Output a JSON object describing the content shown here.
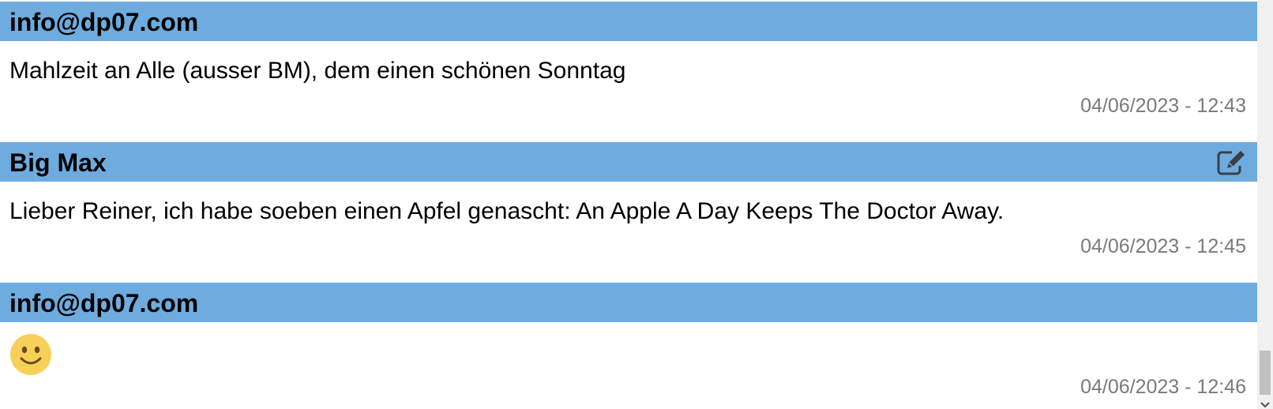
{
  "posts": [
    {
      "author": "info@dp07.com",
      "message": "Mahlzeit an Alle (ausser BM), dem einen schönen Sonntag",
      "timestamp": "04/06/2023 - 12:43",
      "editable": false
    },
    {
      "author": "Big Max",
      "message": "Lieber Reiner, ich habe soeben einen Apfel genascht: An Apple A Day Keeps The Doctor Away.",
      "timestamp": "04/06/2023 - 12:45",
      "editable": true,
      "edit_icon": "edit-icon"
    },
    {
      "author": "info@dp07.com",
      "message": "",
      "emoji": "smiley-icon",
      "timestamp": "04/06/2023 - 12:46",
      "editable": false
    }
  ],
  "colors": {
    "header_bg": "#6eacdf",
    "timestamp": "#7a7a7a",
    "emoji_face": "#f7d05a"
  }
}
